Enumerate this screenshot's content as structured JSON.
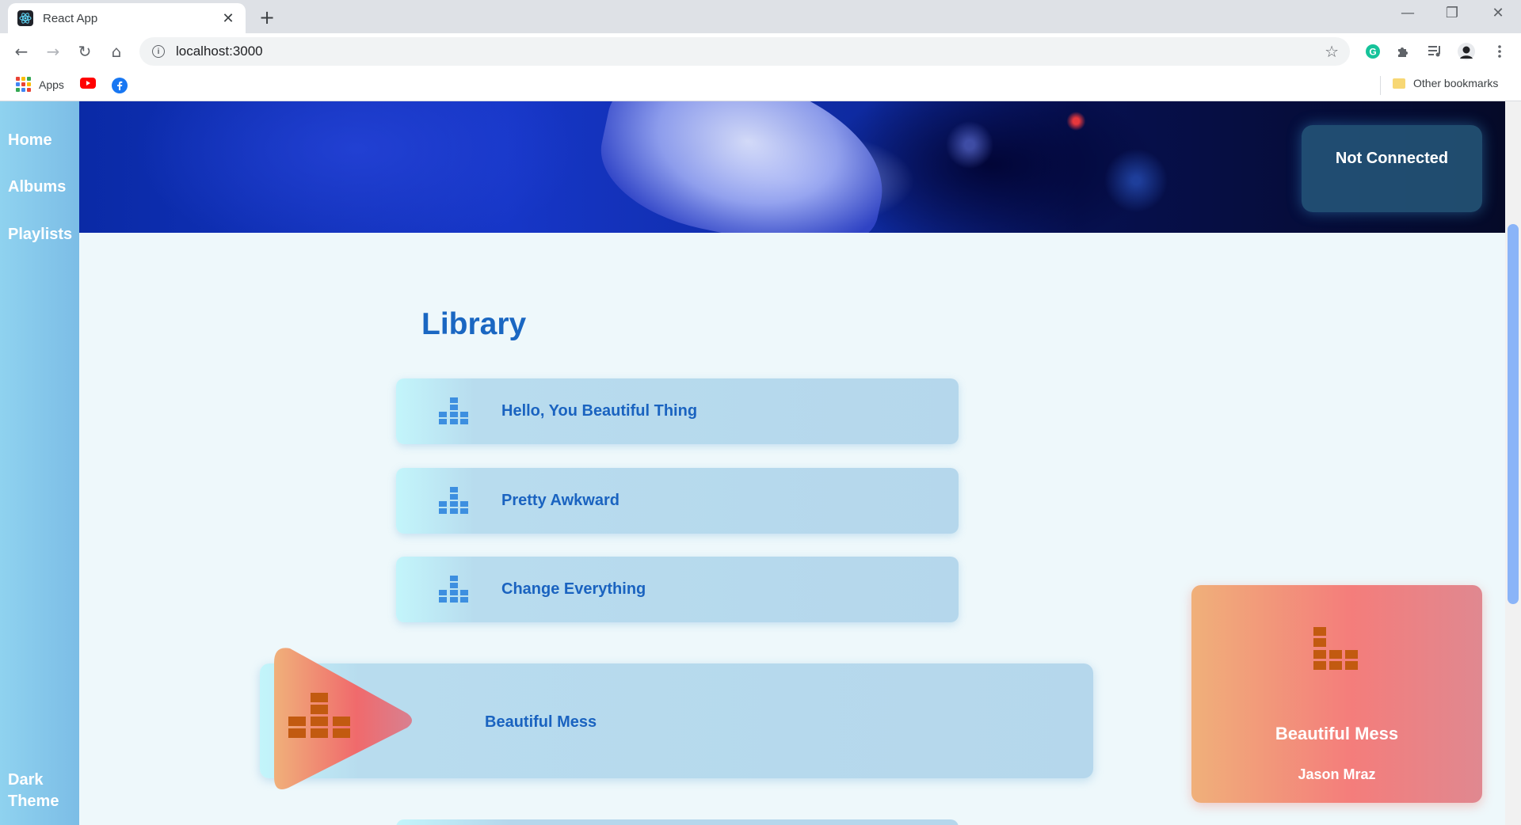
{
  "browser": {
    "tab_title": "React App",
    "tab_close": "✕",
    "new_tab": "+",
    "window_controls": {
      "minimize": "—",
      "restore": "❐",
      "close": "✕"
    },
    "url": "localhost:3000",
    "bookmarks": {
      "apps": "Apps",
      "other": "Other bookmarks"
    }
  },
  "sidebar": {
    "items": [
      {
        "label": "Home"
      },
      {
        "label": "Albums"
      },
      {
        "label": "Playlists"
      }
    ],
    "theme_toggle": "Dark Theme"
  },
  "header": {
    "status": "Not Connected"
  },
  "library": {
    "title": "Library",
    "songs": [
      {
        "title": "Hello, You Beautiful Thing",
        "icon": "bars-icon"
      },
      {
        "title": "Pretty Awkward",
        "icon": "bars-icon"
      },
      {
        "title": "Change Everything",
        "icon": "bars-icon"
      },
      {
        "title": "Beautiful Mess",
        "icon": "play-icon",
        "active": true
      }
    ]
  },
  "now_playing": {
    "title": "Beautiful Mess",
    "artist": "Jason Mraz"
  },
  "colors": {
    "accent_blue": "#1a63c0",
    "card_gradient_start": "#f0b07a",
    "card_gradient_end": "#e08890",
    "icon_blue": "#3d8fe0",
    "icon_orange": "#c25a10"
  }
}
